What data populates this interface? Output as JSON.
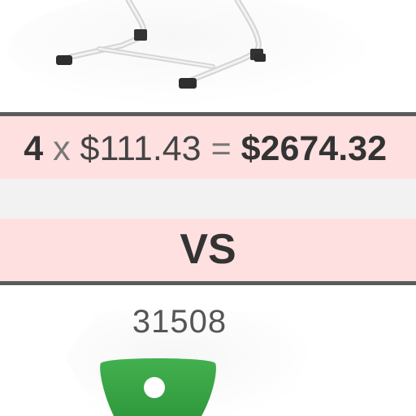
{
  "comparison": {
    "quantity": "4",
    "times_symbol": "x",
    "unit_price": "$111.43",
    "equals_symbol": "=",
    "total_price": "$2674.32",
    "vs_label": "VS"
  },
  "second_product": {
    "product_id": "31508",
    "image_icon": "green-stool-seat-icon",
    "seat_color": "#3aa84a"
  },
  "first_product": {
    "image_icon": "chair-frame-legs-icon",
    "frame_color": "#e6e6e6"
  },
  "colors": {
    "highlight_row": "#ffe0e0",
    "divider": "#5b5b5b",
    "gap_row": "#f2f2f2"
  }
}
